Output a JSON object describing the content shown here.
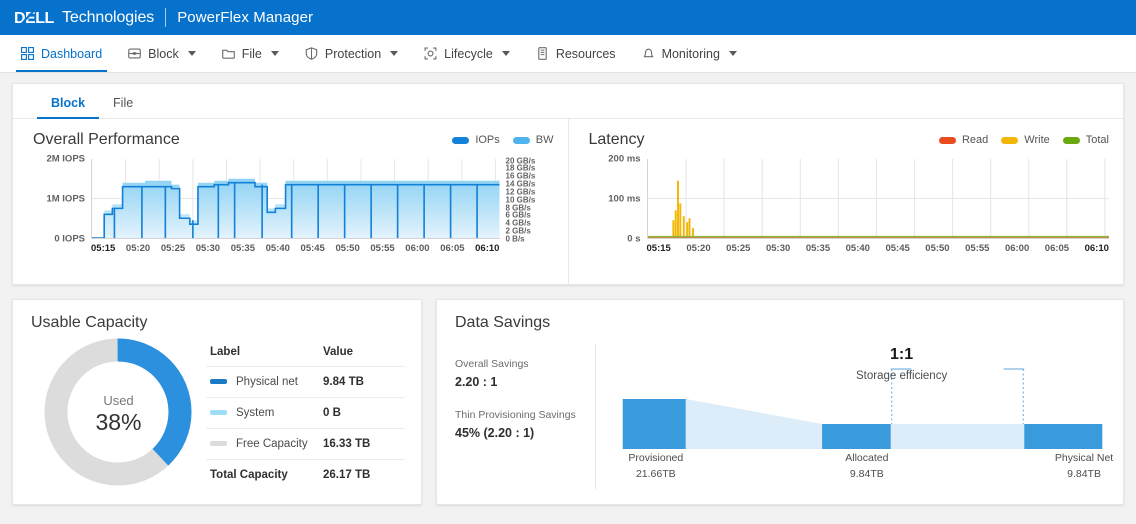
{
  "brand": {
    "logo_text": "DELL",
    "logo_suffix": "Technologies",
    "app_name": "PowerFlex Manager"
  },
  "topnav": {
    "items": [
      {
        "label": "Dashboard",
        "icon": "grid-icon",
        "active": true,
        "caret": false
      },
      {
        "label": "Block",
        "icon": "storage-icon",
        "active": false,
        "caret": true
      },
      {
        "label": "File",
        "icon": "folder-icon",
        "active": false,
        "caret": true
      },
      {
        "label": "Protection",
        "icon": "shield-icon",
        "active": false,
        "caret": true
      },
      {
        "label": "Lifecycle",
        "icon": "lifecycle-icon",
        "active": false,
        "caret": true
      },
      {
        "label": "Resources",
        "icon": "server-icon",
        "active": false,
        "caret": false
      },
      {
        "label": "Monitoring",
        "icon": "bell-icon",
        "active": false,
        "caret": true
      }
    ]
  },
  "tabs": [
    {
      "label": "Block",
      "active": true
    },
    {
      "label": "File",
      "active": false
    }
  ],
  "colors": {
    "brand_blue": "#0672cb",
    "iops": "#1281d7",
    "bw": "#4fb3ee",
    "read": "#ea4b1d",
    "write": "#f2b705",
    "total": "#6aa80d",
    "donut_used": "#2b90dd",
    "donut_free": "#dcdcdc",
    "funnel_bar": "#3a9bdc",
    "funnel_flow": "#dcecf8"
  },
  "performance": {
    "title": "Overall Performance",
    "legend": [
      {
        "label": "IOPs",
        "color": "#1281d7"
      },
      {
        "label": "BW",
        "color": "#4fb3ee"
      }
    ],
    "y_left": [
      "2M IOPS",
      "1M IOPS",
      "0 IOPS"
    ],
    "y_right": [
      "20 GB/s",
      "18 GB/s",
      "16 GB/s",
      "14 GB/s",
      "12 GB/s",
      "10 GB/s",
      "8 GB/s",
      "6 GB/s",
      "4 GB/s",
      "2 GB/s",
      "0 B/s"
    ],
    "x_ticks": [
      "05:15",
      "05:20",
      "05:25",
      "05:30",
      "05:35",
      "05:40",
      "05:45",
      "05:50",
      "05:55",
      "06:00",
      "06:05",
      "06:10"
    ]
  },
  "latency": {
    "title": "Latency",
    "legend": [
      {
        "label": "Read",
        "color": "#ea4b1d"
      },
      {
        "label": "Write",
        "color": "#f2b705"
      },
      {
        "label": "Total",
        "color": "#6aa80d"
      }
    ],
    "y_left": [
      "200 ms",
      "100 ms",
      "0 s"
    ],
    "x_ticks": [
      "05:15",
      "05:20",
      "05:25",
      "05:30",
      "05:35",
      "05:40",
      "05:45",
      "05:50",
      "05:55",
      "06:00",
      "06:05",
      "06:10"
    ]
  },
  "usable_capacity": {
    "title": "Usable Capacity",
    "donut": {
      "center_label": "Used",
      "center_value": "38%",
      "used_pct": 38
    },
    "table": {
      "headers": {
        "label": "Label",
        "value": "Value"
      },
      "rows": [
        {
          "label": "Physical net",
          "value": "9.84 TB",
          "color": "#1a7cc4"
        },
        {
          "label": "System",
          "value": "0 B",
          "color": "#9fdcf7"
        },
        {
          "label": "Free Capacity",
          "value": "16.33 TB",
          "color": "#dcdcdc"
        }
      ],
      "total": {
        "label": "Total Capacity",
        "value": "26.17 TB"
      }
    }
  },
  "data_savings": {
    "title": "Data Savings",
    "metrics": [
      {
        "key": "Overall Savings",
        "value": "2.20 : 1"
      },
      {
        "key": "Thin Provisioning Savings",
        "value": "45% (2.20 : 1)"
      }
    ],
    "efficiency": {
      "ratio": "1:1",
      "caption": "Storage efficiency"
    },
    "stages": [
      {
        "label": "Provisioned",
        "value": "21.66TB"
      },
      {
        "label": "Allocated",
        "value": "9.84TB"
      },
      {
        "label": "Physical Net",
        "value": "9.84TB"
      }
    ]
  },
  "chart_data": [
    {
      "type": "area",
      "title": "Overall Performance",
      "xlabel": "",
      "ylabel": "IOPS",
      "y2label": "Bandwidth",
      "ylim": [
        0,
        2000000
      ],
      "y2lim": [
        0,
        20
      ],
      "grid": true,
      "legend_position": "top-right",
      "x": [
        "05:15",
        "05:20",
        "05:25",
        "05:30",
        "05:35",
        "05:40",
        "05:45",
        "05:50",
        "05:55",
        "06:00",
        "06:05",
        "06:10"
      ],
      "series": [
        {
          "name": "IOPs",
          "unit": "IOPS",
          "color": "#1281d7",
          "values": [
            0,
            1300000,
            1300000,
            350000,
            1300000,
            1300000,
            1300000,
            1350000,
            1350000,
            1350000,
            1350000,
            1350000
          ]
        },
        {
          "name": "BW",
          "unit": "GB/s",
          "color": "#4fb3ee",
          "values": [
            0,
            14,
            14,
            5,
            15,
            15,
            14,
            14.5,
            14.5,
            14.5,
            14.5,
            14.5
          ]
        }
      ]
    },
    {
      "type": "line",
      "title": "Latency",
      "xlabel": "",
      "ylabel": "Latency (ms)",
      "ylim": [
        0,
        200
      ],
      "grid": true,
      "legend_position": "top-right",
      "x": [
        "05:15",
        "05:20",
        "05:25",
        "05:30",
        "05:35",
        "05:40",
        "05:45",
        "05:50",
        "05:55",
        "06:00",
        "06:05",
        "06:10"
      ],
      "series": [
        {
          "name": "Read",
          "color": "#ea4b1d",
          "values": [
            0,
            0,
            0,
            0,
            0,
            0,
            0,
            0,
            0,
            0,
            0,
            0
          ]
        },
        {
          "name": "Write",
          "color": "#f2b705",
          "values": [
            0,
            145,
            0,
            0,
            0,
            0,
            0,
            0,
            0,
            0,
            0,
            0
          ]
        },
        {
          "name": "Total",
          "color": "#6aa80d",
          "values": [
            0,
            2,
            0,
            0,
            0,
            0,
            0,
            0,
            0,
            0,
            0,
            0
          ]
        }
      ],
      "annotations": [
        "Write latency spike of ~145 ms just after 05:16"
      ]
    },
    {
      "type": "pie",
      "title": "Usable Capacity",
      "labels": [
        "Physical net",
        "System",
        "Free Capacity"
      ],
      "values": [
        9.84,
        0,
        16.33
      ],
      "unit": "TB",
      "center_text": "Used 38%",
      "total": 26.17
    },
    {
      "type": "bar",
      "title": "Data Savings",
      "categories": [
        "Provisioned",
        "Allocated",
        "Physical Net"
      ],
      "values": [
        21.66,
        9.84,
        9.84
      ],
      "unit": "TB",
      "ylabel": "Capacity",
      "annotations": [
        "Storage efficiency 1:1 between Allocated and Physical Net"
      ]
    }
  ]
}
